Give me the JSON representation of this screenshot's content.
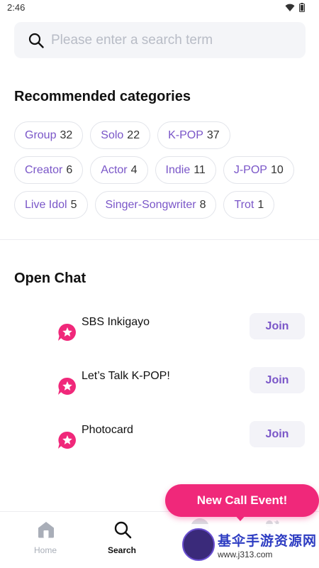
{
  "status_bar": {
    "time": "2:46",
    "icons": [
      "wifi-icon",
      "battery-icon"
    ]
  },
  "search": {
    "placeholder": "Please enter a search term",
    "value": ""
  },
  "recommended": {
    "title": "Recommended categories",
    "rows": [
      [
        {
          "name": "Group",
          "count": "32"
        },
        {
          "name": "Solo",
          "count": "22"
        },
        {
          "name": "K-POP",
          "count": "37"
        }
      ],
      [
        {
          "name": "Creator",
          "count": "6"
        },
        {
          "name": "Actor",
          "count": "4"
        },
        {
          "name": "Indie",
          "count": "11"
        },
        {
          "name": "J-POP",
          "count": "10"
        }
      ],
      [
        {
          "name": "Live Idol",
          "count": "5"
        },
        {
          "name": "Singer-Songwriter",
          "count": "8"
        },
        {
          "name": "Trot",
          "count": "1"
        }
      ]
    ]
  },
  "open_chat": {
    "title": "Open Chat",
    "items": [
      {
        "name": "SBS Inkigayo",
        "action": "Join"
      },
      {
        "name": "Let’s Talk K-POP!",
        "action": "Join"
      },
      {
        "name": "Photocard",
        "action": "Join"
      }
    ]
  },
  "event_banner": {
    "label": "New Call Event!"
  },
  "bottom_nav": {
    "items": [
      {
        "label": "Home",
        "icon": "home-icon",
        "active": false
      },
      {
        "label": "Search",
        "icon": "search-icon",
        "active": true
      }
    ]
  },
  "watermark": {
    "title": "基伞手游资源网",
    "url": "www.j313.com"
  },
  "colors": {
    "accent": "#7a56c8",
    "event": "#f0287a",
    "chip_border": "#e2e4ea",
    "search_bg": "#f4f5f8"
  }
}
